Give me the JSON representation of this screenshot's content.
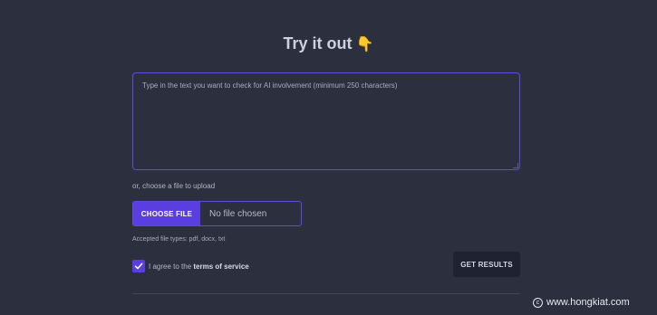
{
  "header": {
    "title": "Try it out",
    "emoji": "👇"
  },
  "text_input": {
    "placeholder": "Type in the text you want to check for AI involvement (minimum 250 characters)",
    "value": ""
  },
  "upload": {
    "or_label": "or, choose a file to upload",
    "choose_button": "CHOOSE FILE",
    "no_file_text": "No file chosen",
    "accepted_types": "Accepted file types: pdf, docx, txt"
  },
  "terms": {
    "checked": true,
    "prefix": "I agree to the ",
    "link": "terms of service"
  },
  "submit": {
    "label": "GET RESULTS"
  },
  "watermark": {
    "symbol": "c",
    "text": "www.hongkiat.com"
  },
  "colors": {
    "background": "#2c2f3d",
    "accent": "#5b3ee0",
    "button_dark": "#1f2230"
  }
}
